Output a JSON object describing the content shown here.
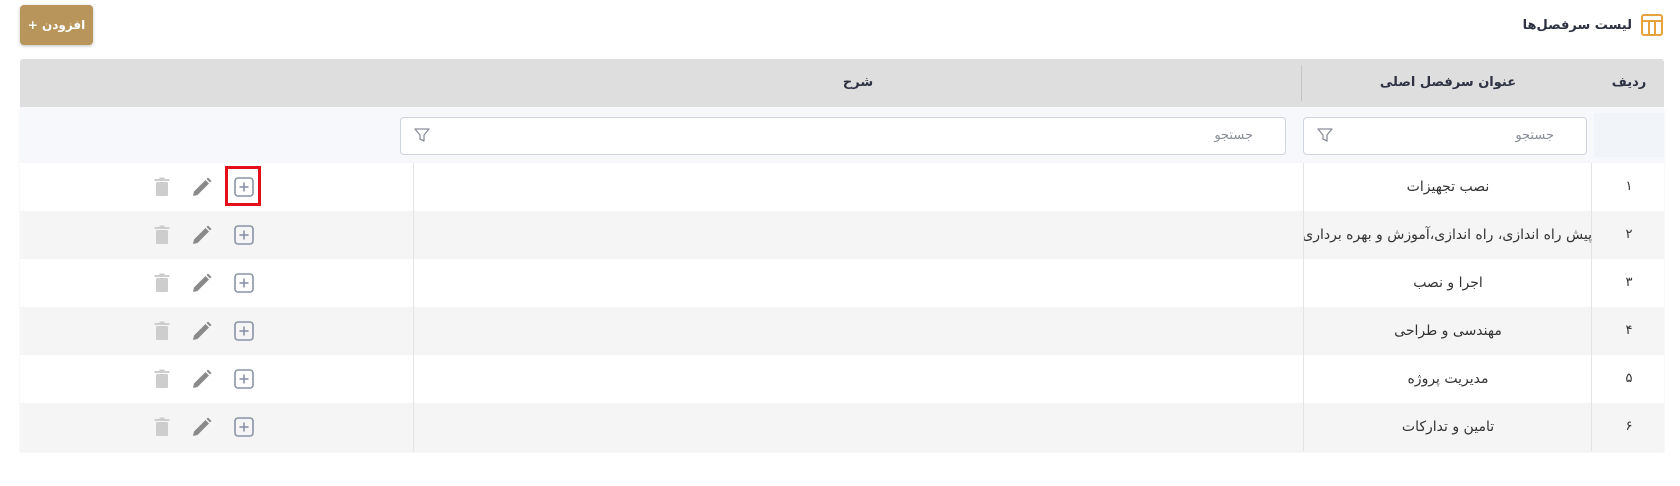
{
  "header": {
    "title": "لیست سرفصل‌ها",
    "add_button_label": "+ افزودن"
  },
  "table": {
    "columns": {
      "row_number": "ردیف",
      "main_title": "عنوان سرفصل اصلی",
      "description": "شرح"
    },
    "filters": {
      "main_title_placeholder": "جستجو",
      "description_placeholder": "جستجو"
    },
    "rows": [
      {
        "num": "۱",
        "title": "نصب تجهیزات",
        "description": ""
      },
      {
        "num": "۲",
        "title": "پیش راه اندازی، راه اندازی،آموزش و بهره برداری",
        "description": ""
      },
      {
        "num": "۳",
        "title": "اجرا و نصب",
        "description": ""
      },
      {
        "num": "۴",
        "title": "مهندسی و طراحی",
        "description": ""
      },
      {
        "num": "۵",
        "title": "مدیریت پروژه",
        "description": ""
      },
      {
        "num": "۶",
        "title": "تامین و تدارکات",
        "description": ""
      }
    ],
    "row_actions": [
      "plus-square-icon",
      "pencil-icon",
      "trash-icon"
    ]
  },
  "colors": {
    "accent": "#b8955a",
    "header_bg": "#dedede",
    "highlight": "#e3101a"
  }
}
